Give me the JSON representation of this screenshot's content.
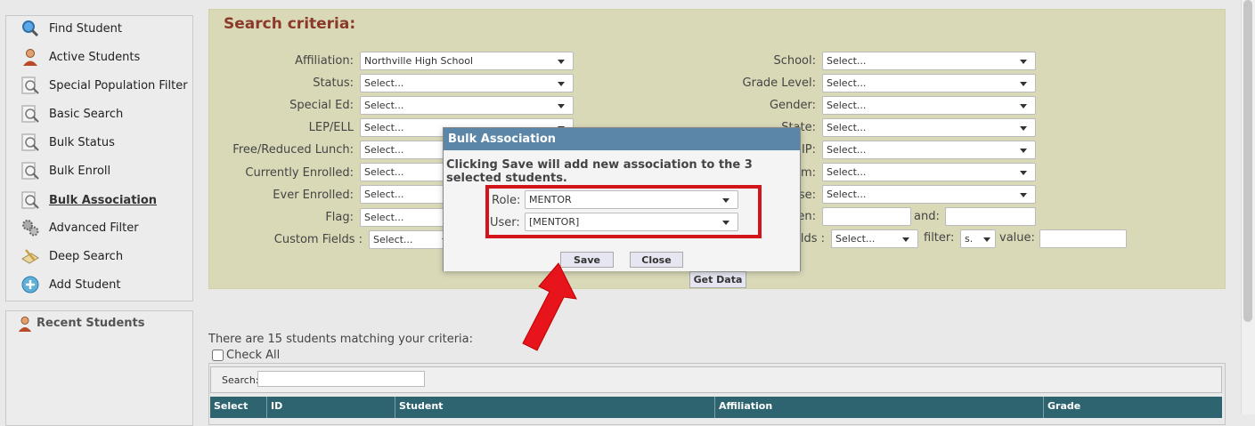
{
  "sidebar": {
    "items": [
      {
        "label": "Find Student",
        "icon": "magnifier-icon"
      },
      {
        "label": "Active Students",
        "icon": "student-person-icon"
      },
      {
        "label": "Special Population Filter",
        "icon": "doc-search-icon"
      },
      {
        "label": "Basic Search",
        "icon": "doc-search-icon"
      },
      {
        "label": "Bulk Status",
        "icon": "doc-search-icon"
      },
      {
        "label": "Bulk Enroll",
        "icon": "doc-search-icon"
      },
      {
        "label": "Bulk Association",
        "icon": "doc-search-icon"
      },
      {
        "label": "Advanced Filter",
        "icon": "gears-icon"
      },
      {
        "label": "Deep Search",
        "icon": "pencil-paper-icon"
      },
      {
        "label": "Add Student",
        "icon": "add-globe-icon"
      }
    ],
    "recent_title": "Recent Students"
  },
  "criteria": {
    "title": "Search criteria:",
    "left": [
      {
        "label": "Affiliation:",
        "value": "Northville High School"
      },
      {
        "label": "Status:",
        "value": "Select..."
      },
      {
        "label": "Special Ed:",
        "value": "Select..."
      },
      {
        "label": "LEP/ELL",
        "value": "Select..."
      },
      {
        "label": "Free/Reduced Lunch:",
        "value": "Select..."
      },
      {
        "label": "Currently Enrolled:",
        "value": "Select..."
      },
      {
        "label": "Ever Enrolled:",
        "value": "Select..."
      },
      {
        "label": "Flag:",
        "value": "Select..."
      }
    ],
    "custom_fields_label": "Custom Fields :",
    "custom_fields_value": "Select...",
    "right": [
      {
        "label": "School:",
        "value": "Select..."
      },
      {
        "label": "Grade Level:",
        "value": "Select..."
      },
      {
        "label": "Gender:",
        "value": "Select..."
      },
      {
        "label": "State:",
        "value": "Select..."
      },
      {
        "label": "IP:",
        "value": "Select..."
      },
      {
        "label": "m:",
        "value": "Select..."
      },
      {
        "label": "se:",
        "value": "Select..."
      }
    ],
    "between_label": "en:",
    "and_label": "and:",
    "fields_label": "lds :",
    "fields_value": "Select...",
    "filter_label": "filter:",
    "filter_value": "s.",
    "value_label": "value:",
    "get_data": "Get Data"
  },
  "results": {
    "summary": "There are 15 students matching your criteria:",
    "check_all": "Check All",
    "search_label": "Search:",
    "columns": [
      "Select",
      "ID",
      "Student",
      "Affiliation",
      "Grade"
    ]
  },
  "modal": {
    "title": "Bulk Association",
    "message": "Clicking Save will add new association to the 3 selected students.",
    "role_label": "Role:",
    "role_value": "MENTOR",
    "user_label": "User:",
    "user_value": "[MENTOR]",
    "save": "Save",
    "close": "Close"
  },
  "colors": {
    "criteria_bg": "#d9d9b8",
    "criteria_title": "#8b3a2a",
    "modal_header": "#5b86a8",
    "table_header": "#2e6470",
    "highlight": "#d4141b"
  }
}
